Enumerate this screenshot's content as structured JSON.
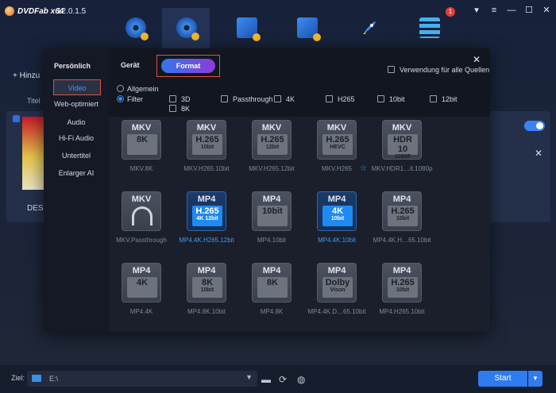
{
  "app": {
    "title": "DVDFab x64",
    "version": "12.0.1.5",
    "notification_count": "1",
    "window_controls": [
      "pin-icon",
      "menu-icon",
      "minimize-icon",
      "maximize-icon",
      "close-icon"
    ]
  },
  "background": {
    "add_label": "Hinzu",
    "titel_label": "Titel",
    "item_name": "DES"
  },
  "modal": {
    "sidebar": {
      "header": "Persönlich",
      "items": [
        {
          "label": "Video",
          "active": true
        },
        {
          "label": "Web-optimiert",
          "active": false
        },
        {
          "label": "Audio",
          "active": false
        },
        {
          "label": "Hi-Fi Audio",
          "active": false
        },
        {
          "label": "Untertitel",
          "active": false
        },
        {
          "label": "Enlarger AI",
          "active": false
        }
      ]
    },
    "tabs": {
      "geraet": "Gerät",
      "format": "Format"
    },
    "apply_all": "Verwendung für alle Quellen",
    "radios": {
      "allgemein": "Allgemein",
      "filter": "Filter"
    },
    "filters": [
      "3D",
      "Passthrough",
      "4K",
      "H265",
      "10bit",
      "12bit",
      "8K"
    ],
    "tiles": [
      {
        "kind": "MKV",
        "sub1": "8K",
        "sub2": "",
        "label": "MKV.8K",
        "selected": false
      },
      {
        "kind": "MKV",
        "sub1": "H.265",
        "sub2": "10bit",
        "label": "MKV.H265.10bit",
        "selected": false
      },
      {
        "kind": "MKV",
        "sub1": "H.265",
        "sub2": "12bit",
        "label": "MKV.H265.12bit",
        "selected": false
      },
      {
        "kind": "MKV",
        "sub1": "H.265",
        "sub2": "HEVC",
        "label": "MKV.H265",
        "selected": false
      },
      {
        "kind": "MKV",
        "sub1": "HDR 10",
        "sub2": "1080P",
        "label": "MKV.HDR1…it.1080p",
        "selected": false
      },
      {
        "kind": "MKV",
        "sub1": "",
        "sub2": "",
        "label": "MKV.Passthrough",
        "selected": false
      },
      {
        "kind": "MP4",
        "sub1": "H.265",
        "sub2": "4K 12bit",
        "label": "MP4.4K.H265.12bit",
        "selected": true
      },
      {
        "kind": "MP4",
        "sub1": "10bit",
        "sub2": "",
        "label": "MP4.10bit",
        "selected": false
      },
      {
        "kind": "MP4",
        "sub1": "4K",
        "sub2": "10bit",
        "label": "MP4.4K.10bit",
        "selected": true
      },
      {
        "kind": "MP4",
        "sub1": "H.265",
        "sub2": "10bit",
        "label": "MP4.4K.H…65.10bit",
        "selected": false
      },
      {
        "kind": "MP4",
        "sub1": "4K",
        "sub2": "",
        "label": "MP4.4K",
        "selected": false
      },
      {
        "kind": "MP4",
        "sub1": "8K",
        "sub2": "10bit",
        "label": "MP4.8K.10bit",
        "selected": false
      },
      {
        "kind": "MP4",
        "sub1": "8K",
        "sub2": "",
        "label": "MP4.8K",
        "selected": false
      },
      {
        "kind": "MP4",
        "sub1": "Dolby",
        "sub2": "Vison",
        "label": "MP4.4K.D…65.10bit",
        "selected": false
      },
      {
        "kind": "MP4",
        "sub1": "H.265",
        "sub2": "10bit",
        "label": "MP4.H265.10bit",
        "selected": false
      }
    ]
  },
  "bottom": {
    "ziel_label": "Ziel:",
    "path": "E:\\",
    "start": "Start"
  },
  "colors": {
    "accent": "#2f7bf0",
    "selection_border": "#e0523f",
    "selected_text": "#3e9bf2"
  }
}
